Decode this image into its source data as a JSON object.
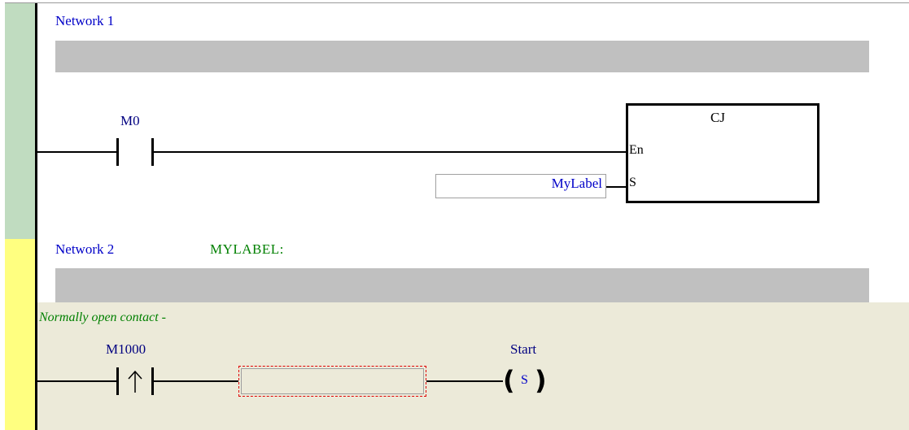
{
  "networks": [
    {
      "title": "Network 1",
      "label": "",
      "contact": {
        "device": "M0",
        "type": "normally-open"
      },
      "instruction": {
        "name": "CJ",
        "pins": {
          "enable": "En",
          "source": "S"
        },
        "operand": "MyLabel"
      }
    },
    {
      "title": "Network 2",
      "label": "MYLABEL:",
      "comment": "Normally open contact -",
      "contact": {
        "device": "M1000",
        "type": "rising-edge"
      },
      "coil": {
        "device": "Start",
        "type": "set",
        "symbol": "S"
      }
    }
  ],
  "colors": {
    "network1_margin": "#c0dcc0",
    "network2_margin": "#ffff80",
    "comment_background": "#ecead9",
    "title_text": "#0000c8",
    "label_text": "#008000",
    "edit_border": "#e00000"
  }
}
